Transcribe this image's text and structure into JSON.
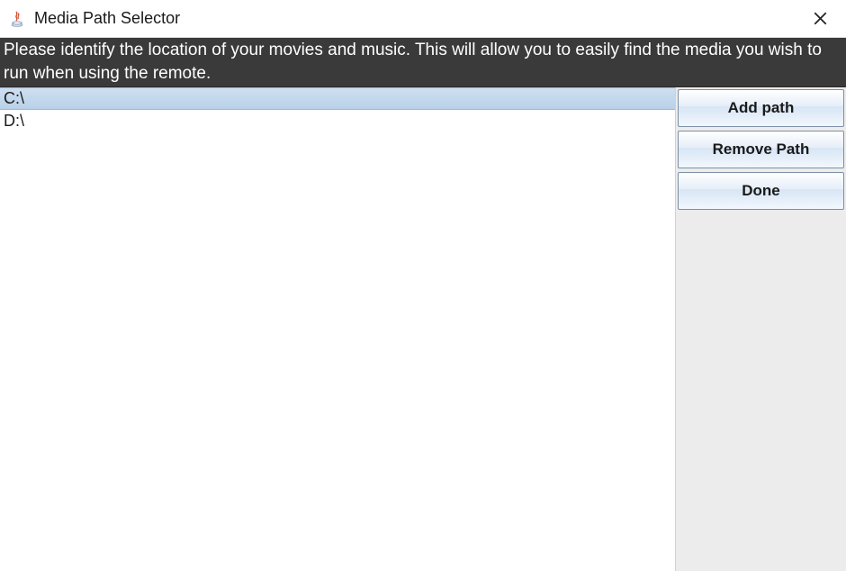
{
  "titlebar": {
    "title": "Media Path Selector"
  },
  "instruction": "Please identify the location of your movies and music. This will allow you to easily find the media you wish to run when using the remote.",
  "paths": {
    "items": [
      {
        "path": "C:\\",
        "selected": true
      },
      {
        "path": "D:\\",
        "selected": false
      }
    ]
  },
  "buttons": {
    "add": "Add path",
    "remove": "Remove Path",
    "done": "Done"
  }
}
